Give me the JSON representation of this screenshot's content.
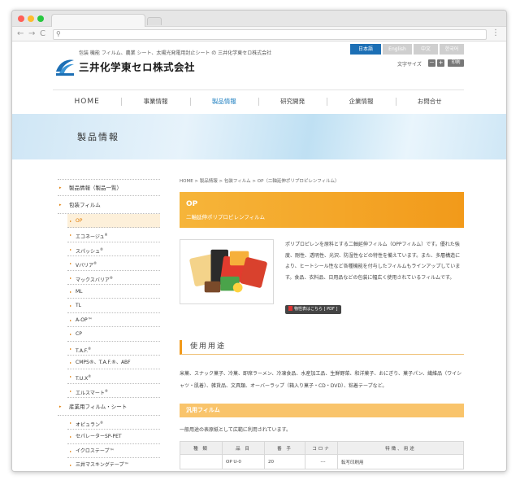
{
  "browser": {
    "back": "←",
    "forward": "→",
    "reload": "C",
    "url": "",
    "menu": "⋮"
  },
  "header": {
    "tagline": "包装 機能 フィルム、農業 シート、太陽光発電用封止シート の 三井化学東セロ株式会社",
    "company_name": "三井化学東セロ株式会社",
    "logo_small_text": "三井化学",
    "languages": [
      "日本語",
      "English",
      "中文",
      "한국어"
    ],
    "font_size_label": "文字サイズ",
    "font_minus": "－",
    "font_plus": "+",
    "print_label": "印刷"
  },
  "gnav": {
    "items": [
      "HOME",
      "事業情報",
      "製品情報",
      "研究開発",
      "企業情報",
      "お問合せ"
    ],
    "active_index": 2
  },
  "hero": {
    "title": "製品情報"
  },
  "sidebar": {
    "items": [
      {
        "label": "製品情報（製品一覧）",
        "level": "top"
      },
      {
        "label": "包装フィルム",
        "level": "group"
      },
      {
        "label": "OP",
        "level": "sub",
        "active": true
      },
      {
        "label": "エコネージュ",
        "sup": "®",
        "level": "sub"
      },
      {
        "label": "スパッシュ",
        "sup": "®",
        "level": "sub"
      },
      {
        "label": "Vバリア",
        "sup": "®",
        "level": "sub"
      },
      {
        "label": "マックスバリア",
        "sup": "®",
        "level": "sub"
      },
      {
        "label": "ML",
        "level": "sub"
      },
      {
        "label": "TL",
        "level": "sub"
      },
      {
        "label": "A-OP™",
        "level": "sub"
      },
      {
        "label": "CP",
        "level": "sub"
      },
      {
        "label": "T.A.F.",
        "sup": "®",
        "level": "sub"
      },
      {
        "label": "CMPS®、T.A.F.®、ABF",
        "level": "sub"
      },
      {
        "label": "T.U.X",
        "sup": "®",
        "level": "sub"
      },
      {
        "label": "エルスマート",
        "sup": "®",
        "level": "sub"
      },
      {
        "label": "産業用フィルム・シート",
        "level": "group"
      },
      {
        "label": "オピュラン",
        "sup": "®",
        "level": "sub"
      },
      {
        "label": "セパレーターSP-PET",
        "level": "sub"
      },
      {
        "label": "イクロステープ™",
        "level": "sub"
      },
      {
        "label": "三井マスキングテープ™",
        "level": "sub"
      }
    ]
  },
  "main": {
    "breadcrumb": "HOME > 製品情報 > 包装フィルム > OP（二軸延伸ポリプロピレンフィルム）",
    "product_name": "OP",
    "product_subtitle": "二軸延伸ポリプロピレンフィルム",
    "description": "ポリプロピレンを原料とする二軸延伸フィルム（OPPフィルム）です。優れた強度、剛性、透明性、光沢、防湿性などの特性を備えています。また、多層構造により、ヒートシール性など各種機能を付与したフィルムもラインアップしています。食品、衣料品、日用品などの包装に幅広く使用されているフィルムです。",
    "pdf_button": "物性表はこちら [ PDF ]",
    "usage_heading": "使用用途",
    "usage_text": "米菓、スナック菓子、冷菓、即席ラーメン、冷凍食品、水産加工品、生鮮野菜、和洋菓子、おにぎり、菓子パン、繊維品（ワイシャツ・肌着）、雑貨品、文具類、オーバーラップ（箱入り菓子・CD・DVD）、粘着テープなど。",
    "film_heading": "汎用フィルム",
    "film_note": "一般用途の表原紙として広範に利用されています。",
    "table": {
      "headers": [
        "種 類",
        "品 目",
        "番 手",
        "コロナ",
        "特徴、用途"
      ],
      "rows": [
        [
          "",
          "OP U-0",
          "20",
          "---",
          "転写印刷用"
        ]
      ]
    }
  },
  "colors": {
    "accent_orange": "#f29a1a",
    "brand_blue": "#1c6fb5"
  }
}
